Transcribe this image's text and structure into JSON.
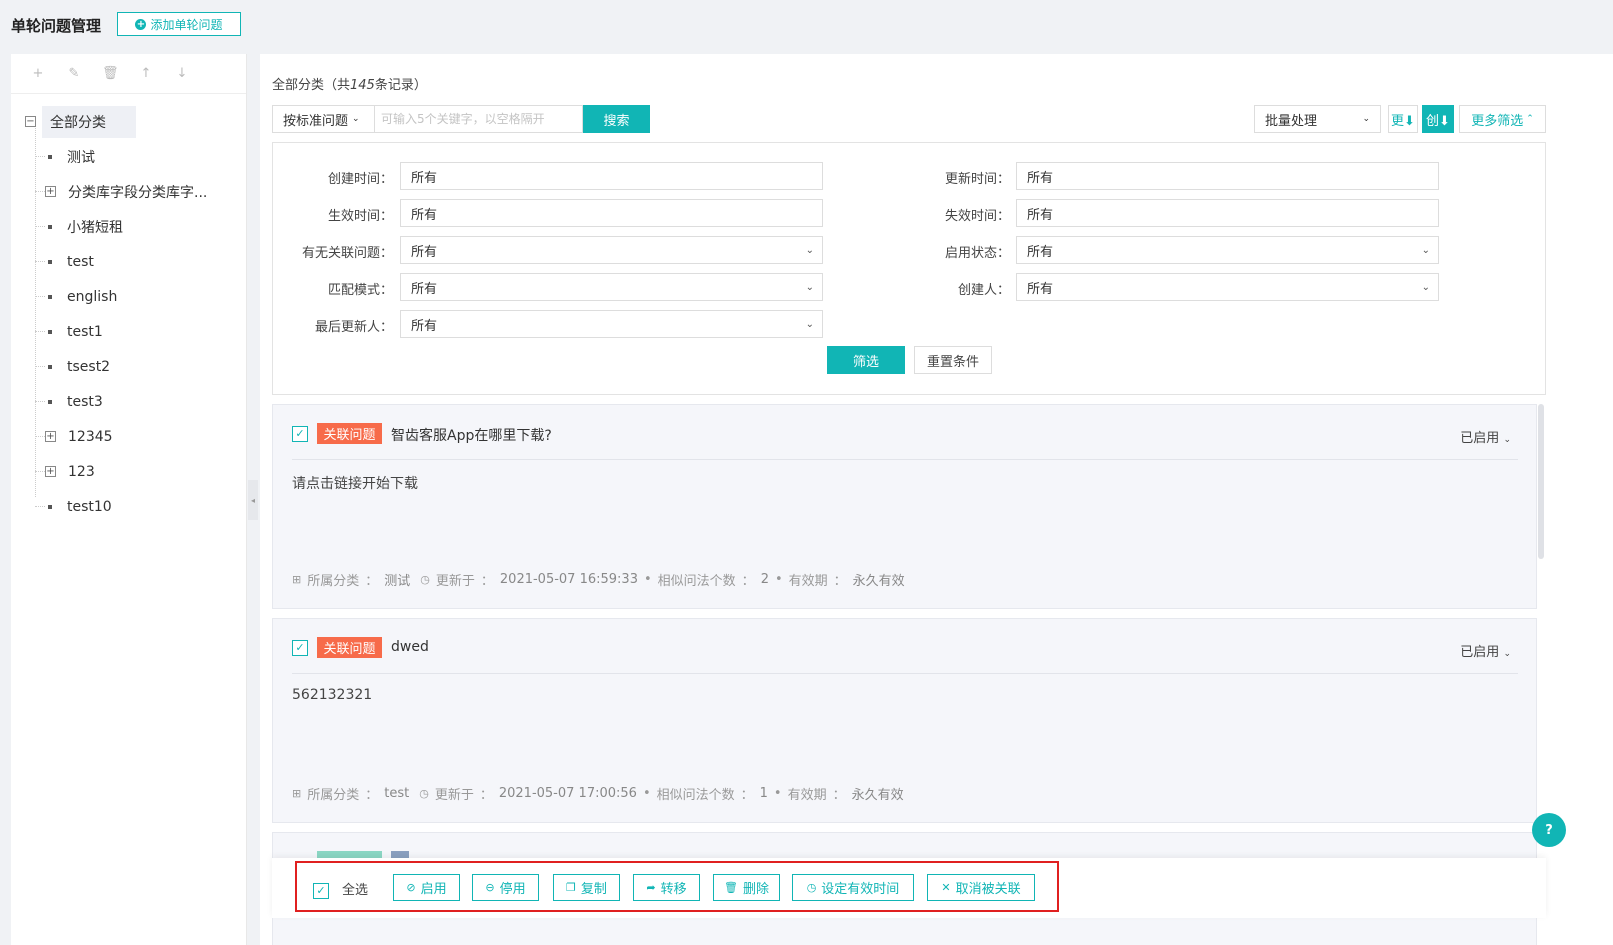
{
  "header": {
    "title": "单轮问题管理",
    "add_button": "添加单轮问题",
    "add_icon": "plus-circle-icon"
  },
  "sidebar": {
    "tools": [
      "+",
      "✎",
      "🗑",
      "↑",
      "↓"
    ],
    "root_label": "全部分类",
    "items": [
      {
        "label": "测试",
        "expandable": false
      },
      {
        "label": "分类库字段分类库字...",
        "expandable": true
      },
      {
        "label": "小猪短租",
        "expandable": false
      },
      {
        "label": "test",
        "expandable": false
      },
      {
        "label": "english",
        "expandable": false
      },
      {
        "label": "test1",
        "expandable": false
      },
      {
        "label": "tsest2",
        "expandable": false
      },
      {
        "label": "test3",
        "expandable": false
      },
      {
        "label": "12345",
        "expandable": true
      },
      {
        "label": "123",
        "expandable": true
      },
      {
        "label": "test10",
        "expandable": false
      }
    ]
  },
  "main": {
    "count_prefix": "全部分类（共",
    "count_value": "145",
    "count_suffix": "条记录）",
    "search_type": "按标准问题",
    "search_placeholder": "可输入5个关键字，以空格隔开",
    "search_button": "搜索",
    "batch_label": "批量处理",
    "sort_update": "更⬇",
    "sort_create": "创⬇",
    "more_filter": "更多筛选",
    "filters": {
      "create_time": {
        "label": "创建时间：",
        "value": "所有"
      },
      "update_time": {
        "label": "更新时间：",
        "value": "所有"
      },
      "effective_time": {
        "label": "生效时间：",
        "value": "所有"
      },
      "expire_time": {
        "label": "失效时间：",
        "value": "所有"
      },
      "has_related": {
        "label": "有无关联问题：",
        "value": "所有"
      },
      "enable_state": {
        "label": "启用状态：",
        "value": "所有"
      },
      "match_mode": {
        "label": "匹配模式：",
        "value": "所有"
      },
      "creator": {
        "label": "创建人：",
        "value": "所有"
      },
      "last_updater": {
        "label": "最后更新人：",
        "value": "所有"
      },
      "filter_button": "筛选",
      "reset_button": "重置条件"
    },
    "cards": [
      {
        "tag": "关联问题",
        "title": "智齿客服App在哪里下载?",
        "status": "已启用",
        "answer": "请点击链接开始下载",
        "category_label": "所属分类",
        "category": "测试",
        "updated_label": "更新于",
        "updated": "2021-05-07 16:59:33",
        "similar_label": "相似问法个数",
        "similar": "2",
        "validity_label": "有效期",
        "validity": "永久有效"
      },
      {
        "tag": "关联问题",
        "title": "dwed",
        "status": "已启用",
        "answer": "562132321",
        "category_label": "所属分类",
        "category": "test",
        "updated_label": "更新于",
        "updated": "2021-05-07 17:00:56",
        "similar_label": "相似问法个数",
        "similar": "1",
        "validity_label": "有效期",
        "validity": "永久有效"
      }
    ],
    "bottom": {
      "select_all": "全选",
      "enable": "启用",
      "disable": "停用",
      "copy": "复制",
      "move": "转移",
      "delete": "删除",
      "set_validity": "设定有效时间",
      "unlink": "取消被关联"
    }
  },
  "colors": {
    "accent": "#11b5b5",
    "tag": "#f76b4a",
    "highlight_frame": "#e02020"
  }
}
